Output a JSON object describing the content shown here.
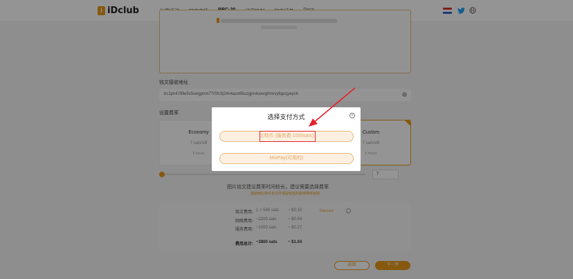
{
  "header": {
    "logo_mark": "i",
    "logo_text": "iDclub",
    "nav": [
      {
        "label": "比赛活动",
        "active": false
      },
      {
        "label": "铭文市场",
        "active": false
      },
      {
        "label": "BRC-20",
        "active": true
      },
      {
        "label": "通用铭刻",
        "active": false
      },
      {
        "label": "铭文订单",
        "active": false
      },
      {
        "label": "Docs",
        "active": false
      }
    ],
    "icons": [
      "flag-icon",
      "twitter-icon",
      "globe-icon"
    ]
  },
  "form": {
    "receive_address_label": "铭文接收地址",
    "receive_address_value": "bc1pn479fw5c5vwgpnm77r5fc3j24n4aze65uzgjrn4uwvg0mrvy6gcqyeych",
    "fee_label": "设置费率",
    "fee_options": [
      {
        "name": "Economy",
        "rate": "7 sats/vB",
        "time": "6 hours"
      },
      {
        "name": "Custom",
        "rate": "7 sats/vB",
        "time": "6 hours"
      }
    ],
    "slider_value": "7",
    "hint_primary": "图片铭文建议费率时间较长，建议需要选择费率",
    "hint_secondary": "需使用比特币支付并保留较低的费率等待铭刻"
  },
  "summary": {
    "rows": [
      {
        "label": "铭文费用:",
        "value": "1 × 546 sats",
        "usd": "~ $0.15"
      },
      {
        "label": "网络费用:",
        "value": "~2200 sats",
        "usd": "~ $0.59"
      },
      {
        "label": "服务费用:",
        "value": "~1000 sats",
        "usd": "~ $0.27"
      }
    ],
    "total_label": "费用总计:",
    "total_value": "~3800 sats",
    "total_usd": "~ $1.04",
    "discount_label": "Discount"
  },
  "buttons": {
    "back": "返回",
    "next": "下一步"
  },
  "modal": {
    "title": "选择支付方式",
    "close_glyph": "×",
    "btc_option": "比特币 (服务费 1000sats)",
    "mix_option": "MixPay(可用的)"
  },
  "colors": {
    "accent": "#e79a1b",
    "annotation": "#e5202a"
  }
}
